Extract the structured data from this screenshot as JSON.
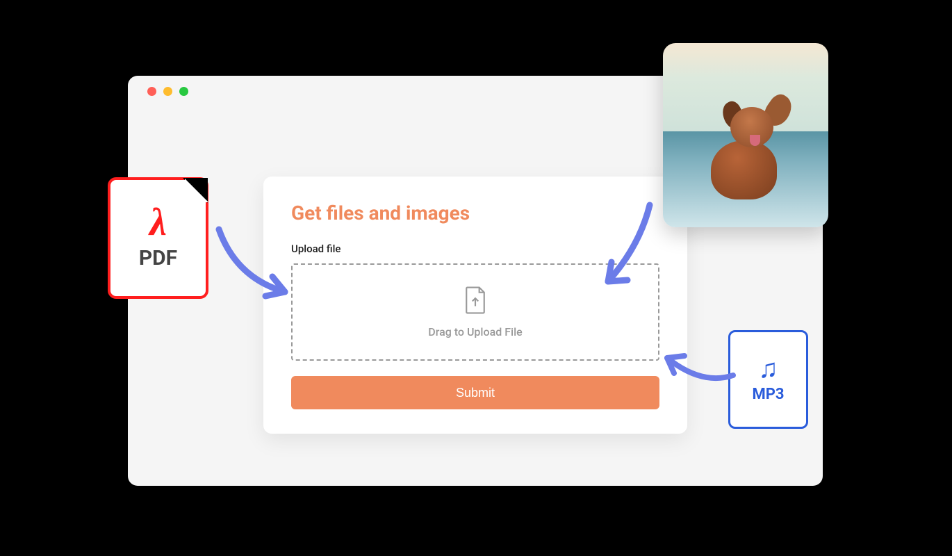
{
  "card": {
    "title": "Get files and images",
    "upload_label": "Upload file",
    "dropzone_text": "Drag to Upload File",
    "submit_label": "Submit"
  },
  "icons": {
    "pdf_label": "PDF",
    "mp3_label": "MP3"
  },
  "photo": {
    "alt": "Dog on beach"
  }
}
